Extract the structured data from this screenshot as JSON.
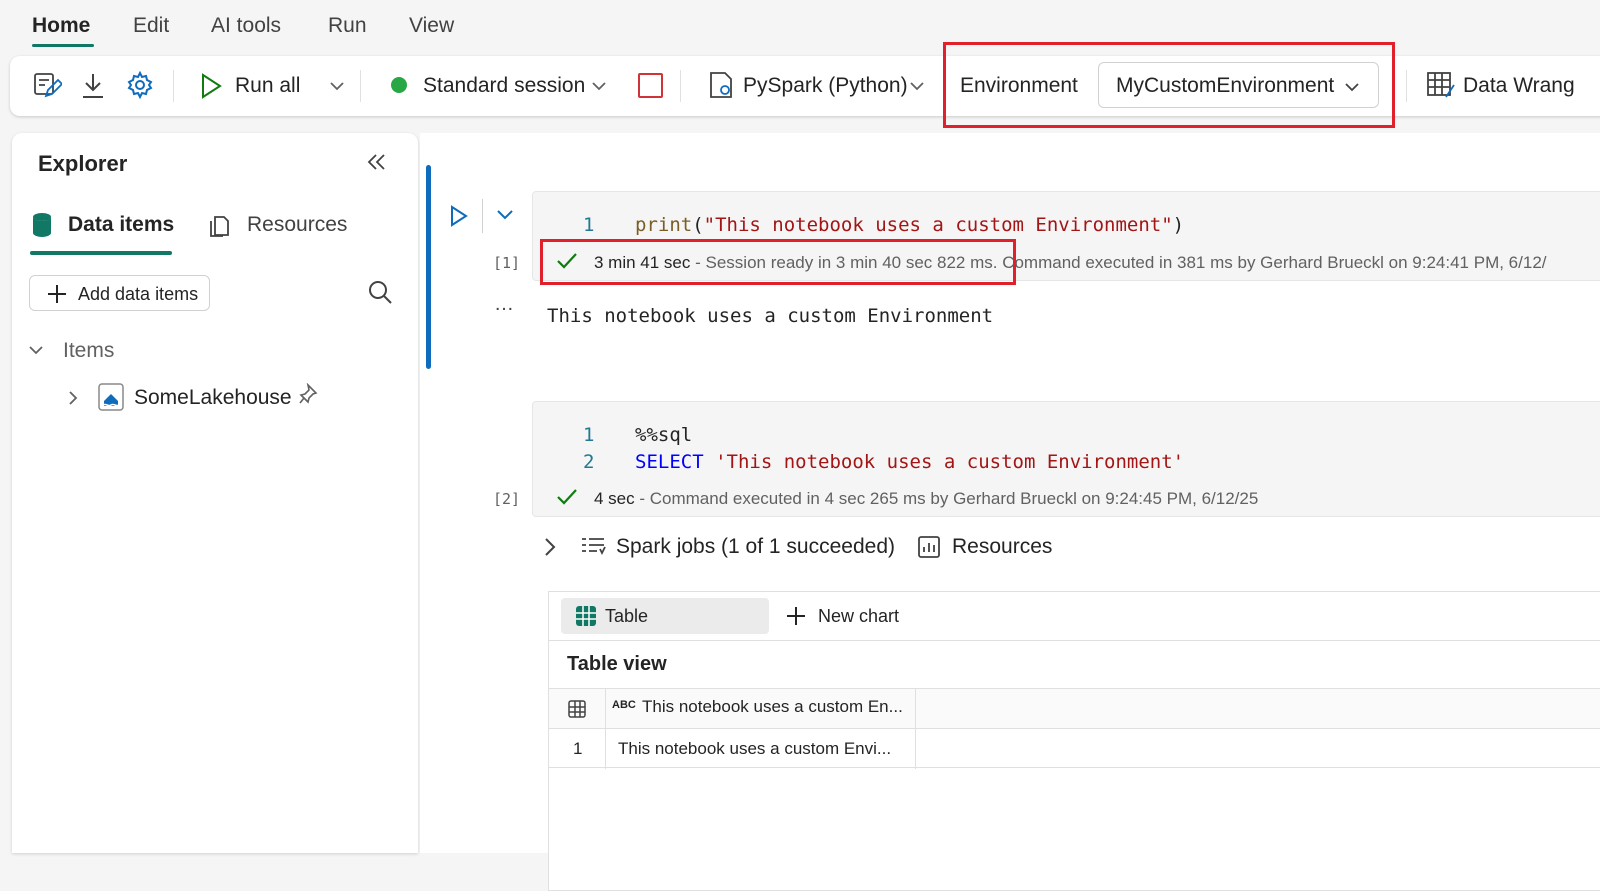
{
  "menu": {
    "items": [
      "Home",
      "Edit",
      "AI tools",
      "Run",
      "View"
    ],
    "active": "Home"
  },
  "toolbar": {
    "run_all_label": "Run all",
    "session_label": "Standard session",
    "session_status_color": "#28a745",
    "language_label": "PySpark (Python)",
    "environment_label": "Environment",
    "environment_value": "MyCustomEnvironment",
    "data_wrangler_label": "Data Wrang"
  },
  "explorer": {
    "title": "Explorer",
    "tabs": [
      {
        "label": "Data items",
        "active": true
      },
      {
        "label": "Resources",
        "active": false
      }
    ],
    "add_button_label": "Add data items",
    "section_label": "Items",
    "items": [
      {
        "label": "SomeLakehouse",
        "icon": "lakehouse-icon"
      }
    ]
  },
  "cells": [
    {
      "exec_count": "[1]",
      "line_numbers": [
        "1"
      ],
      "code_fn": "print",
      "code_string": "\"This notebook uses a custom Environment\"",
      "status_duration": "3 min 41 sec",
      "status_rest": " - Session ready in 3 min 40 sec 822 ms. Command executed in 381 ms by Gerhard Brueckl on 9:24:41 PM, 6/12/",
      "output_marker": "…",
      "output": "This notebook uses a custom Environment"
    },
    {
      "exec_count": "[2]",
      "line_numbers": [
        "1",
        "2"
      ],
      "code_line1": "%%sql",
      "code_kw": "SELECT",
      "code_string": "'This notebook uses a custom Environment'",
      "status_duration": "4 sec",
      "status_rest": " - Command executed in 4 sec 265 ms by Gerhard Brueckl on 9:24:45 PM, 6/12/25",
      "spark_jobs_label": "Spark jobs (1 of 1 succeeded)",
      "resources_label": "Resources",
      "result": {
        "tabs": [
          "Table",
          "New chart"
        ],
        "view_title": "Table view",
        "type_badge": "ABC",
        "column_header": "This notebook uses a custom En...",
        "rows": [
          {
            "index": "1",
            "value": "This notebook uses a custom Envi..."
          }
        ]
      }
    }
  ],
  "colors": {
    "accent": "#117865",
    "highlight": "#e0202a",
    "active_cell": "#0f6cbd"
  }
}
